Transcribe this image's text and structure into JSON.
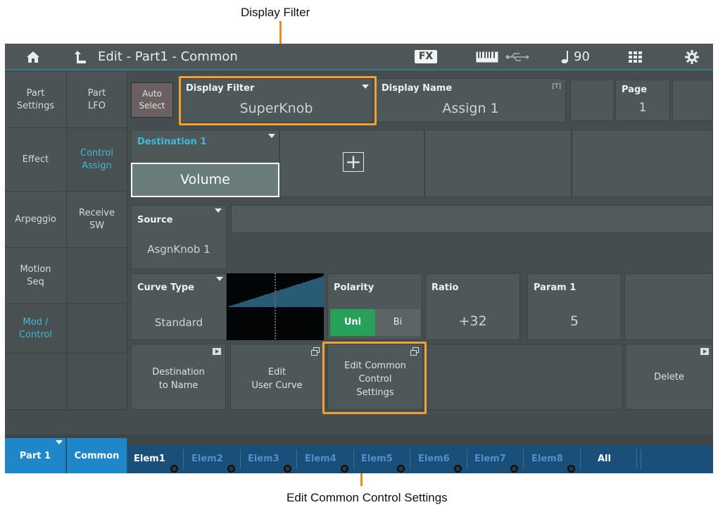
{
  "callouts": {
    "top": "Display Filter",
    "bottom": "Edit Common Control Settings"
  },
  "header": {
    "title": "Edit - Part1 - Common",
    "fx": "FX",
    "tempo": "90"
  },
  "nav_left": [
    "Part\nSettings",
    "Effect",
    "Arpeggio",
    "Motion\nSeq",
    "Mod /\nControl",
    ""
  ],
  "nav_right": [
    "Part\nLFO",
    "Control\nAssign",
    "Receive\nSW",
    "",
    "",
    ""
  ],
  "top_row": {
    "auto_select": "Auto\nSelect",
    "display_filter_label": "Display Filter",
    "display_filter_value": "SuperKnob",
    "display_name_label": "Display Name",
    "display_name_tag": "[T]",
    "display_name_value": "Assign 1",
    "page_label": "Page",
    "page_value": "1"
  },
  "destination": {
    "label": "Destination 1",
    "value": "Volume",
    "add_symbol": "+"
  },
  "source": {
    "label": "Source",
    "value": "AsgnKnob 1"
  },
  "curve": {
    "type_label": "Curve Type",
    "type_value": "Standard",
    "polarity_label": "Polarity",
    "polarity_uni": "Uni",
    "polarity_bi": "Bi",
    "ratio_label": "Ratio",
    "ratio_value": "+32",
    "param1_label": "Param 1",
    "param1_value": "5"
  },
  "actions": {
    "destination_to_name": "Destination\nto Name",
    "edit_user_curve": "Edit\nUser Curve",
    "edit_common_control": "Edit Common\nControl\nSettings",
    "delete": "Delete"
  },
  "bottom_tabs": {
    "part": "Part 1",
    "common": "Common"
  },
  "elements": [
    "Elem1",
    "Elem2",
    "Elem3",
    "Elem4",
    "Elem5",
    "Elem6",
    "Elem7",
    "Elem8",
    "All"
  ],
  "colors": {
    "accent_teal": "#2f7e86",
    "callout_orange": "#f5a030",
    "tab_blue": "#1f86c9",
    "uni_green": "#27a05a"
  }
}
